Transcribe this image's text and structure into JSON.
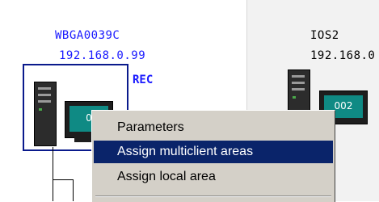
{
  "nodes": [
    {
      "name": "WBGA0039C",
      "ip": "192.168.0.99",
      "status": "REC",
      "screen_label": "0"
    },
    {
      "name": "IOS2",
      "ip": "192.168.0",
      "screen_label": "002"
    }
  ],
  "context_menu": {
    "items": [
      {
        "label": "Parameters",
        "highlighted": false
      },
      {
        "label": "Assign multiclient areas",
        "highlighted": true
      },
      {
        "label": "Assign local area",
        "highlighted": false
      }
    ]
  },
  "colors": {
    "label_blue": "#1a1aff",
    "selection_frame": "#0a1a8c",
    "menu_bg": "#d4d0c8",
    "menu_highlight": "#0a246a",
    "screen": "#0f8a84"
  }
}
